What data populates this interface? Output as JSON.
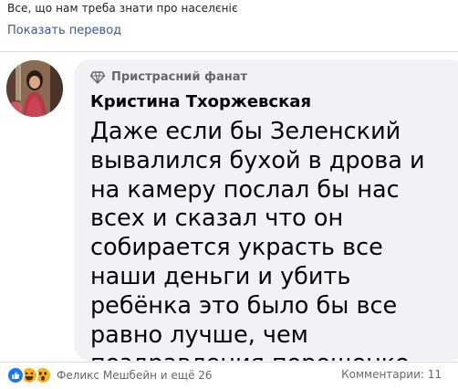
{
  "post": {
    "text": "Все, що нам треба знати про населєніє",
    "translate_link": "Показать перевод"
  },
  "comment": {
    "badge": "Пристрасний фанат",
    "author": "Кристина Тхоржевская",
    "text": "Даже если бы Зеленский вывалился бухой в дрова и на камеру послал бы нас всех и сказал что он собирается украсть все наши деньги и убить ребёнка это было бы все равно лучше, чем поздравления порошенко"
  },
  "footer": {
    "reaction_icons": [
      "like-icon",
      "haha-icon",
      "wow-icon"
    ],
    "reactors": "Феликс Мешбейн и ещё 26",
    "comments": "Комментарии: 11"
  },
  "colors": {
    "link": "#385898",
    "bubble": "#f0f2f5",
    "like": "#1877f2",
    "emoji": "#f7b125",
    "muted": "#65676b"
  }
}
